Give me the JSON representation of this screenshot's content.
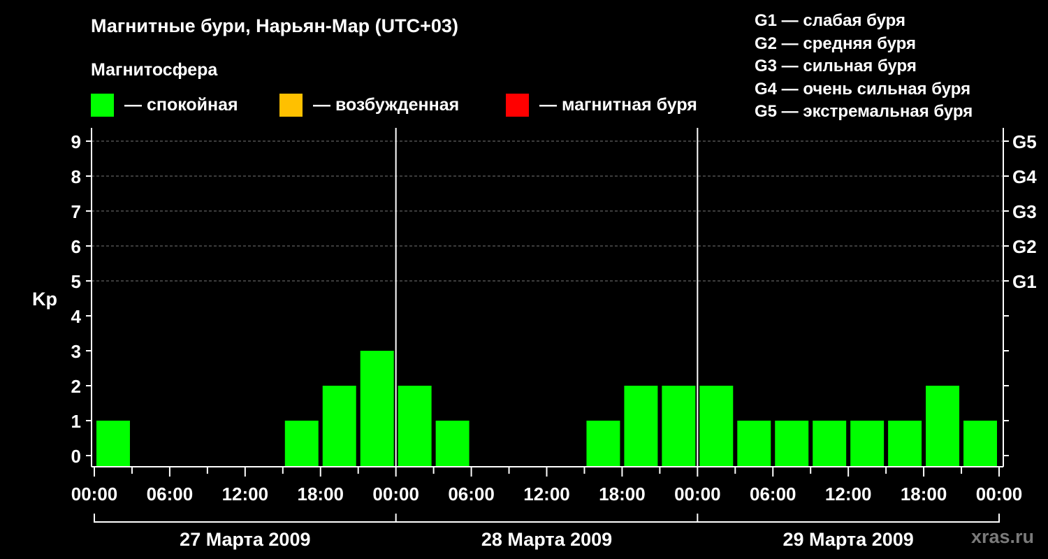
{
  "title": "Магнитные бури, Нарьян-Мар (UTC+03)",
  "subtitle": "Магнитосфера",
  "legend": [
    {
      "label": "— спокойная",
      "color": "#00ff00"
    },
    {
      "label": "— возбужденная",
      "color": "#ffc000"
    },
    {
      "label": "— магнитная буря",
      "color": "#ff0000"
    }
  ],
  "storm_levels": [
    "G1 — слабая буря",
    "G2 — средняя буря",
    "G3 — сильная буря",
    "G4 — очень сильная буря",
    "G5 — экстремальная буря"
  ],
  "watermark": "xras.ru",
  "chart_data": {
    "type": "bar",
    "ylabel": "Kp",
    "ylim": [
      0,
      9
    ],
    "y_ticks": [
      "0",
      "1",
      "2",
      "3",
      "4",
      "5",
      "6",
      "7",
      "8",
      "9"
    ],
    "right_ticks": [
      {
        "value": 5,
        "label": "G1"
      },
      {
        "value": 6,
        "label": "G2"
      },
      {
        "value": 7,
        "label": "G3"
      },
      {
        "value": 8,
        "label": "G4"
      },
      {
        "value": 9,
        "label": "G5"
      }
    ],
    "x_tick_labels": [
      "00:00",
      "06:00",
      "12:00",
      "18:00",
      "00:00",
      "06:00",
      "12:00",
      "18:00",
      "00:00",
      "06:00",
      "12:00",
      "18:00",
      "00:00"
    ],
    "dates": [
      "27 Марта 2009",
      "28 Марта 2009",
      "29 Марта 2009"
    ],
    "grid": "dashed at 5-9",
    "interval_hours": 3,
    "values": [
      1,
      0,
      0,
      0,
      0,
      1,
      2,
      3,
      2,
      1,
      0,
      0,
      0,
      1,
      2,
      2,
      2,
      1,
      1,
      1,
      1,
      1,
      2,
      1
    ],
    "colors": {
      "quiet": "#00ff00"
    }
  }
}
